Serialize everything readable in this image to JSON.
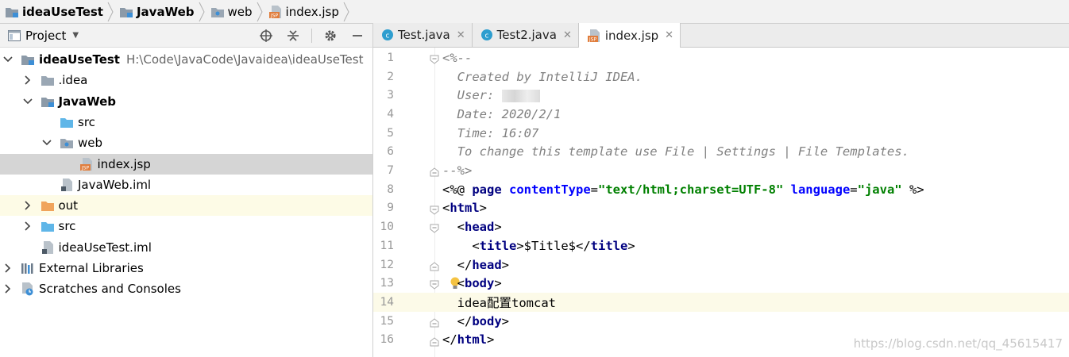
{
  "breadcrumb": [
    {
      "label": "ideaUseTest",
      "icon": "module-folder-icon",
      "bold": true
    },
    {
      "label": "JavaWeb",
      "icon": "module-folder-icon",
      "bold": true
    },
    {
      "label": "web",
      "icon": "web-folder-icon",
      "bold": false
    },
    {
      "label": "index.jsp",
      "icon": "jsp-file-icon",
      "bold": false
    }
  ],
  "project_panel": {
    "title": "Project",
    "tree": [
      {
        "label": "ideaUseTest",
        "path": "H:\\Code\\JavaCode\\Javaidea\\ideaUseTest",
        "bold": true,
        "icon": "module-folder-icon",
        "arrow": "down"
      },
      {
        "label": ".idea",
        "bold": false,
        "icon": "folder-icon",
        "arrow": "right"
      },
      {
        "label": "JavaWeb",
        "bold": true,
        "icon": "module-folder-icon",
        "arrow": "down"
      },
      {
        "label": "src",
        "bold": false,
        "icon": "source-folder-icon",
        "arrow": ""
      },
      {
        "label": "web",
        "bold": false,
        "icon": "web-folder-icon",
        "arrow": "down"
      },
      {
        "label": "index.jsp",
        "bold": false,
        "icon": "jsp-file-icon",
        "arrow": "",
        "selected": true
      },
      {
        "label": "JavaWeb.iml",
        "bold": false,
        "icon": "iml-file-icon",
        "arrow": ""
      },
      {
        "label": "out",
        "bold": false,
        "icon": "excluded-folder-icon",
        "arrow": "right",
        "excluded": true
      },
      {
        "label": "src",
        "bold": false,
        "icon": "source-folder-icon",
        "arrow": "right"
      },
      {
        "label": "ideaUseTest.iml",
        "bold": false,
        "icon": "iml-file-icon",
        "arrow": ""
      },
      {
        "label": "External Libraries",
        "bold": false,
        "icon": "libraries-icon",
        "arrow": "right"
      },
      {
        "label": "Scratches and Consoles",
        "bold": false,
        "icon": "scratches-icon",
        "arrow": "right"
      }
    ]
  },
  "editor": {
    "tabs": [
      {
        "label": "Test.java",
        "icon": "java-class-icon",
        "active": false
      },
      {
        "label": "Test2.java",
        "icon": "java-class-icon",
        "active": false
      },
      {
        "label": "index.jsp",
        "icon": "jsp-file-icon",
        "active": true
      }
    ],
    "lines": [
      {
        "n": "1",
        "fold": "open",
        "tokens": [
          {
            "t": "<%--",
            "c": "comment"
          }
        ]
      },
      {
        "n": "2",
        "fold": "",
        "tokens": [
          {
            "t": "  Created by IntelliJ IDEA.",
            "c": "comment"
          }
        ]
      },
      {
        "n": "3",
        "fold": "",
        "tokens": [
          {
            "t": "  User: ",
            "c": "comment"
          }
        ],
        "redacted": true
      },
      {
        "n": "4",
        "fold": "",
        "tokens": [
          {
            "t": "  Date: 2020/2/1",
            "c": "comment"
          }
        ]
      },
      {
        "n": "5",
        "fold": "",
        "tokens": [
          {
            "t": "  Time: 16:07",
            "c": "comment"
          }
        ]
      },
      {
        "n": "6",
        "fold": "",
        "tokens": [
          {
            "t": "  To change this template use File | Settings | File Templates.",
            "c": "comment"
          }
        ]
      },
      {
        "n": "7",
        "fold": "close",
        "tokens": [
          {
            "t": "--%>",
            "c": "comment"
          }
        ]
      },
      {
        "n": "8",
        "fold": "",
        "tokens": [
          {
            "t": "<%@ ",
            "c": "plain"
          },
          {
            "t": "page ",
            "c": "kw"
          },
          {
            "t": "contentType",
            "c": "attr"
          },
          {
            "t": "=",
            "c": "plain"
          },
          {
            "t": "\"text/html;charset=UTF-8\"",
            "c": "str"
          },
          {
            "t": " ",
            "c": "plain"
          },
          {
            "t": "language",
            "c": "attr"
          },
          {
            "t": "=",
            "c": "plain"
          },
          {
            "t": "\"java\"",
            "c": "str"
          },
          {
            "t": " %>",
            "c": "plain"
          }
        ]
      },
      {
        "n": "9",
        "fold": "open",
        "tokens": [
          {
            "t": "<",
            "c": "plain"
          },
          {
            "t": "html",
            "c": "tag"
          },
          {
            "t": ">",
            "c": "plain"
          }
        ]
      },
      {
        "n": "10",
        "fold": "open",
        "tokens": [
          {
            "t": "  <",
            "c": "plain"
          },
          {
            "t": "head",
            "c": "tag"
          },
          {
            "t": ">",
            "c": "plain"
          }
        ]
      },
      {
        "n": "11",
        "fold": "",
        "tokens": [
          {
            "t": "    <",
            "c": "plain"
          },
          {
            "t": "title",
            "c": "tag"
          },
          {
            "t": ">$Title$</",
            "c": "plain"
          },
          {
            "t": "title",
            "c": "tag"
          },
          {
            "t": ">",
            "c": "plain"
          }
        ]
      },
      {
        "n": "12",
        "fold": "close",
        "tokens": [
          {
            "t": "  </",
            "c": "plain"
          },
          {
            "t": "head",
            "c": "tag"
          },
          {
            "t": ">",
            "c": "plain"
          }
        ]
      },
      {
        "n": "13",
        "fold": "open",
        "tokens": [
          {
            "t": "  <",
            "c": "plain"
          },
          {
            "t": "body",
            "c": "tag"
          },
          {
            "t": ">",
            "c": "plain"
          }
        ],
        "bulb": true
      },
      {
        "n": "14",
        "fold": "",
        "tokens": [
          {
            "t": "  idea配置tomcat",
            "c": "plain"
          }
        ],
        "current": true
      },
      {
        "n": "15",
        "fold": "close",
        "tokens": [
          {
            "t": "  </",
            "c": "plain"
          },
          {
            "t": "body",
            "c": "tag"
          },
          {
            "t": ">",
            "c": "plain"
          }
        ]
      },
      {
        "n": "16",
        "fold": "close",
        "tokens": [
          {
            "t": "</",
            "c": "plain"
          },
          {
            "t": "html",
            "c": "tag"
          },
          {
            "t": ">",
            "c": "plain"
          }
        ]
      }
    ]
  },
  "watermark": "https://blog.csdn.net/qq_45615417",
  "colors": {
    "selection": "#d5d5d5",
    "excluded_row": "#fdfbe6",
    "current_line": "#fcfae8",
    "comment": "#808080",
    "tag": "#000080",
    "attr": "#0000ff",
    "string": "#008000"
  }
}
